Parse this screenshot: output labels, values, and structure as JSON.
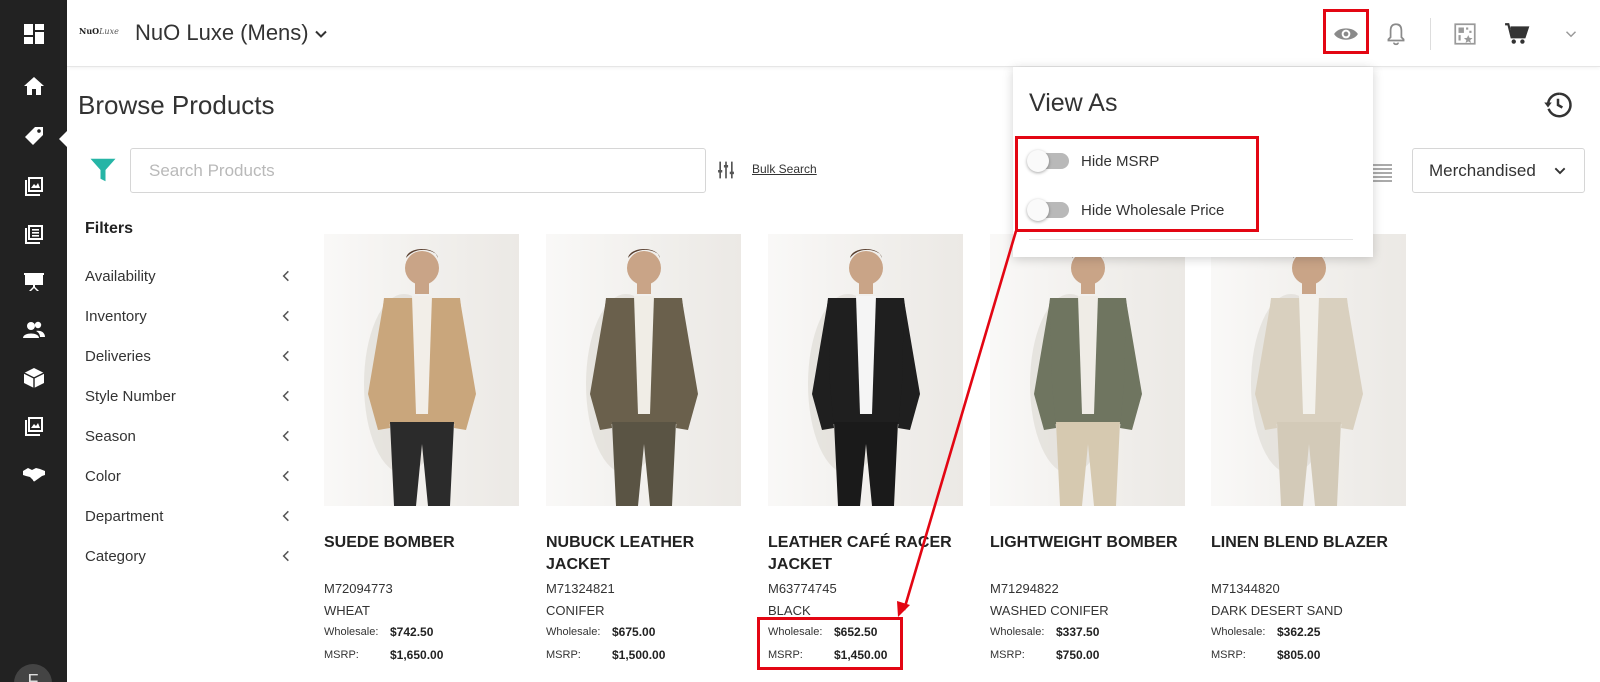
{
  "topbar": {
    "logo_text": "NuO",
    "logo_script": "Luxe",
    "brand_name": "NuO Luxe (Mens)"
  },
  "page": {
    "title": "Browse Products"
  },
  "search": {
    "placeholder": "Search Products",
    "bulk_search_label": "Bulk Search",
    "sort_value": "Merchandised"
  },
  "filters": {
    "title": "Filters",
    "items": [
      {
        "label": "Availability"
      },
      {
        "label": "Inventory"
      },
      {
        "label": "Deliveries"
      },
      {
        "label": "Style Number"
      },
      {
        "label": "Season"
      },
      {
        "label": "Color"
      },
      {
        "label": "Department"
      },
      {
        "label": "Category"
      }
    ]
  },
  "view_as": {
    "title": "View As",
    "toggles": [
      {
        "label": "Hide MSRP",
        "on": false
      },
      {
        "label": "Hide Wholesale Price",
        "on": false
      }
    ]
  },
  "products": [
    {
      "name": "SUEDE BOMBER",
      "style": "M72094773",
      "color": "WHEAT",
      "wholesale_label": "Wholesale:",
      "wholesale": "$742.50",
      "msrp_label": "MSRP:",
      "msrp": "$1,650.00",
      "jacket": "#c9a67c",
      "pants": "#2b2b2b",
      "shirt": "#f2eee8"
    },
    {
      "name": "NUBUCK LEATHER JACKET",
      "style": "M71324821",
      "color": "CONIFER",
      "wholesale_label": "Wholesale:",
      "wholesale": "$675.00",
      "msrp_label": "MSRP:",
      "msrp": "$1,500.00",
      "jacket": "#6a604c",
      "pants": "#5a5444",
      "shirt": "#f0ede6"
    },
    {
      "name": "LEATHER CAFÉ RACER JACKET",
      "style": "M63774745",
      "color": "BLACK",
      "wholesale_label": "Wholesale:",
      "wholesale": "$652.50",
      "msrp_label": "MSRP:",
      "msrp": "$1,450.00",
      "jacket": "#1f1f1f",
      "pants": "#1a1a1a",
      "shirt": "#f5f5f5"
    },
    {
      "name": "LIGHTWEIGHT BOMBER",
      "style": "M71294822",
      "color": "WASHED CONIFER",
      "wholesale_label": "Wholesale:",
      "wholesale": "$337.50",
      "msrp_label": "MSRP:",
      "msrp": "$750.00",
      "jacket": "#6f7560",
      "pants": "#d6c9b0",
      "shirt": "#efece6"
    },
    {
      "name": "LINEN BLEND BLAZER",
      "style": "M71344820",
      "color": "DARK DESERT SAND",
      "wholesale_label": "Wholesale:",
      "wholesale": "$362.25",
      "msrp_label": "MSRP:",
      "msrp": "$805.00",
      "jacket": "#d9d0bf",
      "pants": "#d3cab8",
      "shirt": "#f3f1ec"
    }
  ],
  "colors": {
    "accent_teal": "#26b5a6",
    "highlight_red": "#e30613",
    "rail": "#222222"
  }
}
